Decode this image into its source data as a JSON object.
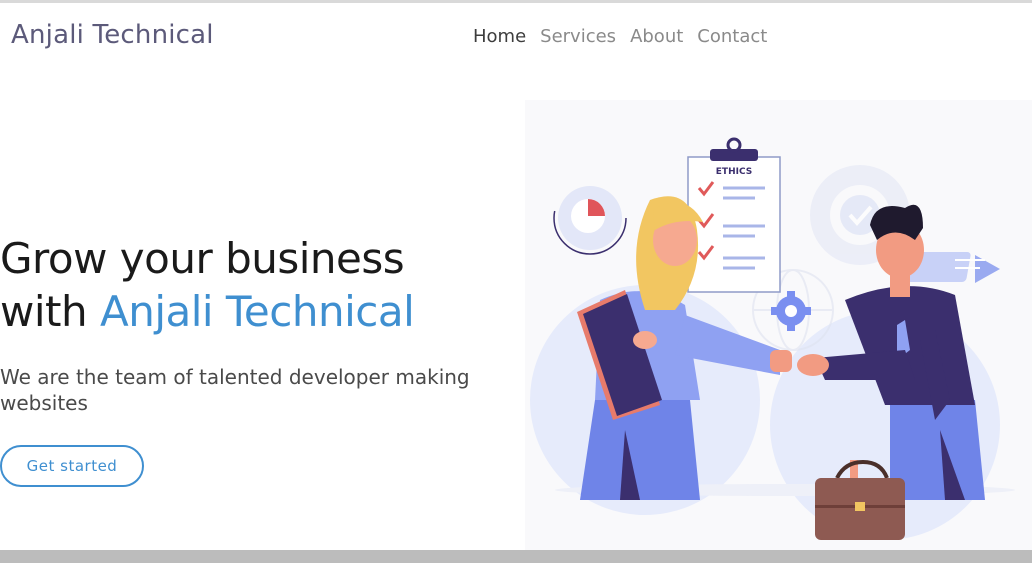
{
  "brand": {
    "name": "Anjali Technical"
  },
  "nav": {
    "items": [
      {
        "label": "Home",
        "active": true
      },
      {
        "label": "Services",
        "active": false
      },
      {
        "label": "About",
        "active": false
      },
      {
        "label": "Contact",
        "active": false
      }
    ]
  },
  "hero": {
    "title_line1": "Grow your business",
    "title_prefix": "with ",
    "title_accent": "Anjali Technical",
    "subtitle": "We are the team of talented developer making websites",
    "cta_label": "Get started"
  },
  "illustration": {
    "clipboard_label": "ETHICS",
    "colors": {
      "accent": "#3f8fd0",
      "navy": "#3b2f6e",
      "periwinkle": "#6f84e8",
      "light_blue": "#e2e7fb",
      "skin": "#f29b82",
      "hair_blonde": "#f2c661",
      "brown_bag": "#8e5a52"
    }
  }
}
